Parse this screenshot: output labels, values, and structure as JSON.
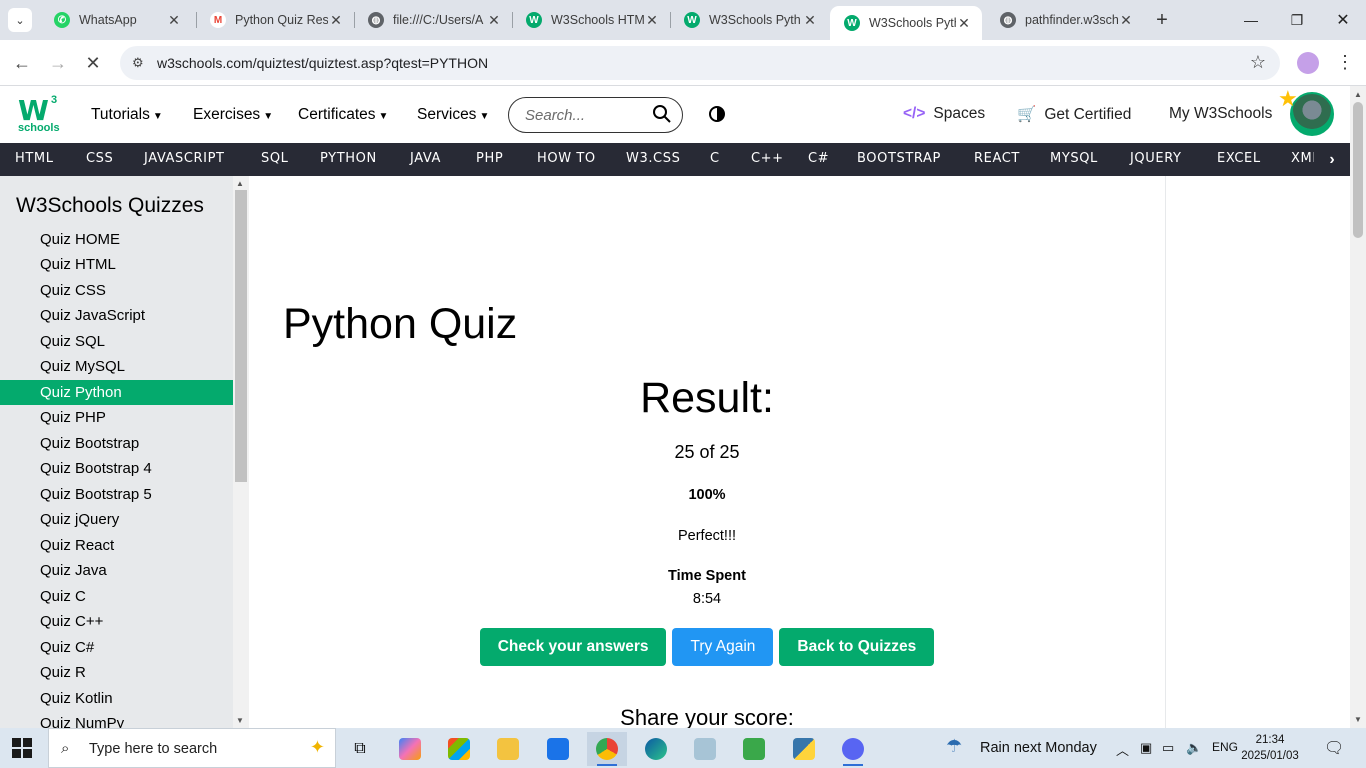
{
  "browser": {
    "tabs": [
      {
        "title": "WhatsApp",
        "color": "#25d366",
        "glyph": "✆"
      },
      {
        "title": "Python Quiz Res",
        "color": "#ea4335",
        "glyph": "M"
      },
      {
        "title": "file:///C:/Users/A",
        "color": "#5f6368",
        "glyph": "◍"
      },
      {
        "title": "W3Schools HTM",
        "color": "#04aa6d",
        "glyph": "W"
      },
      {
        "title": "W3Schools Pyth",
        "color": "#04aa6d",
        "glyph": "W"
      },
      {
        "title": "W3Schools Pyth",
        "color": "#04aa6d",
        "glyph": "W"
      },
      {
        "title": "pathfinder.w3sch",
        "color": "#5f6368",
        "glyph": "◍"
      }
    ],
    "url": "w3schools.com/quiztest/quiztest.asp?qtest=PYTHON"
  },
  "topnav": {
    "menus": [
      "Tutorials",
      "Exercises",
      "Certificates",
      "Services"
    ],
    "search_placeholder": "Search...",
    "spaces": "Spaces",
    "get_certified": "Get Certified",
    "my_w3schools": "My W3Schools",
    "logo_text": "W",
    "logo_sup": "3",
    "logo_sub": "schools"
  },
  "subnav": [
    "HTML",
    "CSS",
    "JAVASCRIPT",
    "SQL",
    "PYTHON",
    "JAVA",
    "PHP",
    "HOW TO",
    "W3.CSS",
    "C",
    "C++",
    "C#",
    "BOOTSTRAP",
    "REACT",
    "MYSQL",
    "JQUERY",
    "EXCEL",
    "XML"
  ],
  "sidebar": {
    "title": "W3Schools Quizzes",
    "items": [
      "Quiz HOME",
      "Quiz HTML",
      "Quiz CSS",
      "Quiz JavaScript",
      "Quiz SQL",
      "Quiz MySQL",
      "Quiz Python",
      "Quiz PHP",
      "Quiz Bootstrap",
      "Quiz Bootstrap 4",
      "Quiz Bootstrap 5",
      "Quiz jQuery",
      "Quiz React",
      "Quiz Java",
      "Quiz C",
      "Quiz C++",
      "Quiz C#",
      "Quiz R",
      "Quiz Kotlin",
      "Quiz NumPy"
    ],
    "active_index": 6
  },
  "main": {
    "title": "Python Quiz",
    "result_label": "Result:",
    "score": "25 of 25",
    "percent": "100%",
    "message": "Perfect!!!",
    "time_label": "Time Spent",
    "time_value": "8:54",
    "buttons": {
      "check": "Check your answers",
      "try_again": "Try Again",
      "back": "Back to Quizzes"
    },
    "share": "Share your score:"
  },
  "taskbar": {
    "search_text": "Type here to search",
    "weather": "Rain next Monday",
    "language": "ENG",
    "time": "21:34",
    "date": "2025/01/03"
  },
  "colors": {
    "brand_green": "#04aa6d",
    "button_blue": "#2196f3",
    "subnav_dark": "#282a35"
  }
}
